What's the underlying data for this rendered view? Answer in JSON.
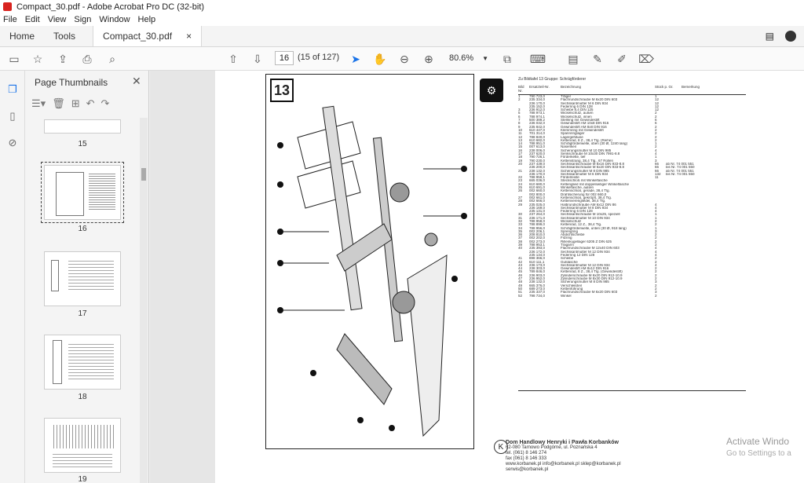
{
  "window": {
    "title": "Compact_30.pdf - Adobe Acrobat Pro DC (32-bit)"
  },
  "menu": [
    "File",
    "Edit",
    "View",
    "Sign",
    "Window",
    "Help"
  ],
  "tabs": {
    "home": "Home",
    "tools": "Tools",
    "doc": "Compact_30.pdf",
    "close": "×"
  },
  "nav": {
    "page_value": "16",
    "page_count": "(15 of 127)",
    "zoom": "80.6%"
  },
  "sidepanel": {
    "title": "Page Thumbnails",
    "thumbs": [
      "15",
      "16",
      "17",
      "18",
      "19"
    ]
  },
  "document": {
    "plate_number": "13",
    "table_header": "Zu Bildtafel 13          Gruppe: Schrägförderer",
    "col_headers": [
      "Bild Nr.",
      "Ersatzteil-Nr.",
      "Bezeichnung",
      "Stück p. Gr.",
      "Bemerkung"
    ],
    "rows": [
      [
        "1",
        "790 723,0",
        "Träger",
        "1",
        ""
      ],
      [
        "2",
        "235 334,0",
        "Flachrundschraube M 6x20 DIN 603",
        "12",
        ""
      ],
      [
        "",
        "236 170,0",
        "Sechskantmutter M 6 DIN 934",
        "12",
        ""
      ],
      [
        "",
        "235 152,0",
        "Federring 6 DIN 128",
        "12",
        ""
      ],
      [
        "3",
        "236 912,0",
        "Scheibe 8,4 DIN 125",
        "12",
        ""
      ],
      [
        "5",
        "788 973,1",
        "Wickelschutz, außen",
        "2",
        ""
      ],
      [
        "6",
        "788 974,1",
        "Wickelschutz, innen",
        "2",
        ""
      ],
      [
        "7",
        "500 389,2",
        "Stellring mit Gewindestift",
        "6",
        ""
      ],
      [
        "8",
        "236 032,0",
        "Gewindestift AM 10x8 DIN 916",
        "6",
        ""
      ],
      [
        "9",
        "235 842,0",
        "Gewindestift AM 8x8 DIN 916",
        "2",
        ""
      ],
      [
        "10",
        "610 447,0",
        "Klemmring mit Gewindestift",
        "2",
        ""
      ],
      [
        "11",
        "701 314,0",
        "Spannringlager",
        "2",
        ""
      ],
      [
        "12",
        "788 840,0",
        "Lagergehäuse",
        "2",
        ""
      ],
      [
        "13",
        "610 682,0",
        "Kettenrad, 8 Z., 38,4 Tlg. (Reihe)",
        "2",
        ""
      ],
      [
        "14",
        "788 951,0",
        "Schrägförderwelle, oben (30 Ø, 1240 lang)",
        "1",
        ""
      ],
      [
        "15",
        "007 613,0",
        "Nasenkeil",
        "2",
        ""
      ],
      [
        "16",
        "238 006,0",
        "Sicherungsmutter M 10 DIN 985",
        "4",
        ""
      ],
      [
        "17",
        "237 620,0",
        "Senkschraube M 10x30 DIN 7991-8.8",
        "4",
        ""
      ],
      [
        "18",
        "790 726,1",
        "Förderkette, tief",
        "1",
        ""
      ],
      [
        "19",
        "790 230,0",
        "Kettenstrang, 38,4 Tlg., 67 Rollen",
        "3",
        ""
      ],
      [
        "20",
        "237 439,0",
        "Sechskantschraube M 8x16 DIN 933-8.8",
        "66",
        "ab Nr. 74 001 551"
      ],
      [
        "",
        "236 200,0",
        "Sechskantschraube M 6x20 DIN 933-8.8",
        "66",
        "bis Nr. 74 001 550"
      ],
      [
        "21",
        "238 132,0",
        "Sicherungsmutter M 8 DIN 985",
        "66",
        "ab Nr. 74 001 551"
      ],
      [
        "",
        "236 170,0",
        "Sechskantmutter M 6 DIN 934",
        "132",
        "bis Nr. 74 001 550"
      ],
      [
        "22",
        "788 959,1",
        "Förderleiste",
        "11",
        ""
      ],
      [
        "23",
        "665 036,0",
        "Steckschloß mit Winkelfasche",
        "",
        ""
      ],
      [
        "24",
        "610 680,0",
        "Kettenglied mit doppelseitiger Winkelfasche",
        "",
        ""
      ],
      [
        "25",
        "610 691,0",
        "Winkelfasche, außen",
        "",
        ""
      ],
      [
        "26",
        "002 660,0",
        "Kettenschloß, gerade, 38,4 Tlg.",
        "",
        ""
      ],
      [
        "",
        "002 800,0",
        "Drahtsicherung für 002 660,0",
        "",
        ""
      ],
      [
        "27",
        "002 661,0",
        "Kettenschloß, gekröpft, 38,4 Tlg.",
        "",
        ""
      ],
      [
        "28",
        "002 666,0",
        "Kettenverengliedel, 38,4 Tlg.",
        "",
        ""
      ],
      [
        "29",
        "235 025,0",
        "Halbrundschraube AM 6x12 DIN 86",
        "4",
        ""
      ],
      [
        "",
        "236 169,0",
        "Sechskantmutter M 8 DIN 934",
        "4",
        ""
      ],
      [
        "",
        "235 131,0",
        "Federring 6 DIN 128",
        "4",
        ""
      ],
      [
        "30",
        "237 264,0",
        "Sechskantschraube M 10x25, speziell",
        "1",
        ""
      ],
      [
        "31",
        "236 171,0",
        "Sechskantmutter M 10 DIN 934",
        "1",
        ""
      ],
      [
        "32",
        "788 958,0",
        "Wickelschutz",
        "2",
        ""
      ],
      [
        "33",
        "788 899,0",
        "Kettenrad, 12 Z., 38,4 Tlg.",
        "2",
        ""
      ],
      [
        "34",
        "788 956,0",
        "Schrägförderwelle, unten (30 Ø, 918 lang)",
        "1",
        ""
      ],
      [
        "35",
        "002 206,1",
        "Sprengring",
        "3",
        ""
      ],
      [
        "36",
        "208 810,0",
        "Abdichtscheibe",
        "2",
        ""
      ],
      [
        "37",
        "002 202,0",
        "Filzring",
        "2",
        ""
      ],
      [
        "38",
        "002 273,0",
        "Rillenkugellager 6205 Z DIN 625",
        "2",
        ""
      ],
      [
        "39",
        "788 953,1",
        "Tragarm",
        "2",
        ""
      ],
      [
        "40",
        "235 393,0",
        "Flachrundschraube M 12x40 DIN 603",
        "4",
        ""
      ],
      [
        "",
        "236 172,0",
        "Sechskantmutter M 12 DIN 934",
        "4",
        ""
      ],
      [
        "",
        "235 134,0",
        "Federring 12 DIN 128",
        "4",
        ""
      ],
      [
        "41",
        "898 366,0",
        "Scheibe",
        "2",
        ""
      ],
      [
        "42",
        "610 111,1",
        "Gußlasche",
        "2",
        ""
      ],
      [
        "43",
        "236 173,0",
        "Sechskantmutter M 12 DIN 934",
        "4",
        ""
      ],
      [
        "44",
        "238 303,0",
        "Gewindestift AM 8x12 DIN 916",
        "2",
        ""
      ],
      [
        "45",
        "789 846,0",
        "Kettenrad, 8 Z., 38,4 Tlg. (Gewindestift)",
        "2",
        ""
      ],
      [
        "46",
        "236 903,0",
        "Zylinderschraube M 6x20 DIN 912-10.9",
        "2",
        ""
      ],
      [
        "47",
        "236 952,0",
        "Zylinderschraube M 8x30 DIN 912-10.9",
        "2",
        ""
      ],
      [
        "48",
        "238 132,0",
        "Sicherungsmutter M 8 DIN 985",
        "3",
        ""
      ],
      [
        "49",
        "665 376,0",
        "Verschleißteil",
        "2",
        ""
      ],
      [
        "50",
        "689 273,0",
        "Kettenführung",
        "2",
        ""
      ],
      [
        "51",
        "235 337,0",
        "Flachrundschraube M 6x20 DIN 603",
        "3",
        ""
      ],
      [
        "52",
        "798 734,0",
        "Winkel",
        "2",
        ""
      ]
    ],
    "dealer": {
      "name": "Dom Handlowy Henryki i Pawła Korbanków",
      "addr": "62-080 Tarnowo Podgórne, ul. Poznańska 4",
      "tel": "tel. (061) 8 146 274",
      "fax": "fax (061) 8 146 333",
      "web": "www.korbanek.pl  info@korbanek.pl  sklep@korbanek.pl  serwis@korbanek.pl"
    }
  },
  "watermark": {
    "line1": "Activate Windo",
    "line2": "Go to Settings to a"
  }
}
